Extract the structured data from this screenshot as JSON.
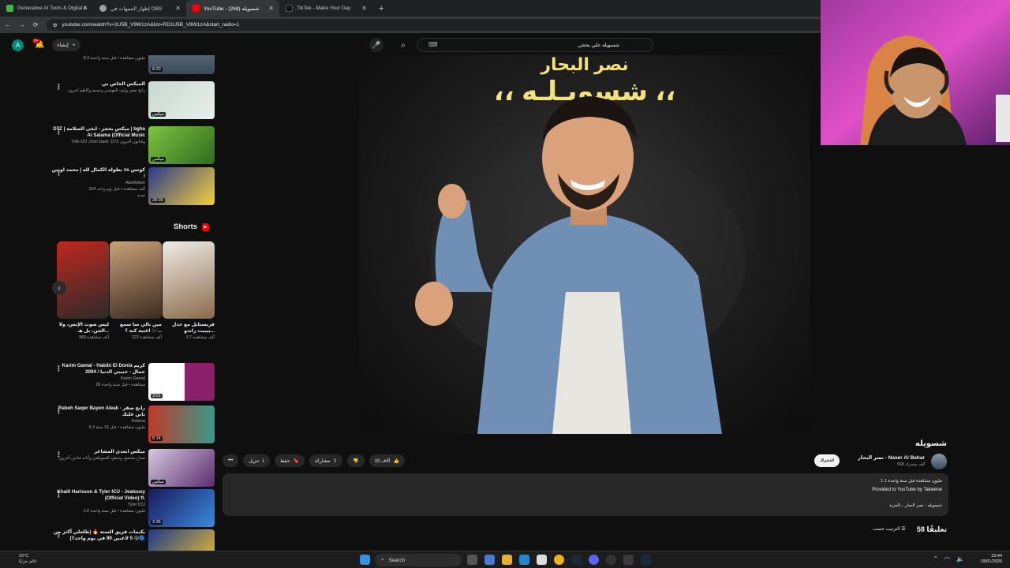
{
  "browser": {
    "tabs": [
      {
        "label": "Generative AI Tools & Digital A",
        "active": false,
        "color": "#4caf50"
      },
      {
        "label": "إظهار التنبيهات في OBS",
        "active": false,
        "color": "#9e9e9e"
      },
      {
        "label": "YouTube - شسويله (268)",
        "active": true,
        "color": "#ff0000"
      },
      {
        "label": "TikTok - Make Your Day",
        "active": false,
        "color": "#111111"
      }
    ],
    "url": "youtube.com/watch?v=1U5B_V9W1zA&list=RD1U5B_V9W1zA&start_radio=1"
  },
  "youtube": {
    "avatar_letter": "A",
    "notif_count": "9+",
    "create_label": "إنشاء",
    "search_value": "شسويله حلي يحجي"
  },
  "sidebar": {
    "top_dur": "8:20",
    "top_meta": "8.3 مليون مشاهدة • قبل سنة واحدة",
    "items": [
      {
        "title": "الميكس الخاص بي",
        "channel": "رابح صقر وإيف العوضي ونسيم وكاظم آخرون",
        "meta": "",
        "dur": "ميكس",
        "color1": "#c8d8d0",
        "color2": "#e8f0ec"
      },
      {
        "title": "D7Z | ميكس بحجز - ابغى السلامة | bgha Al Salama (Official Music",
        "channel": "THE DO ,Dish Dash ,D7Z وفنانون آخرون",
        "meta": "",
        "dur": "ميكس",
        "color1": "#7fc342",
        "color2": "#2f6b1f"
      },
      {
        "title": "بطولة الكمال لله | محمد اوبين vs كوتس !",
        "channel": "AbuRebeh",
        "meta": "324 ألف مشاهدة • قبل يوم واحد",
        "dur": "28:05",
        "badge": "جديد",
        "color1": "#2a3a8a",
        "color2": "#f6d03a"
      },
      {
        "title": "Karim Gamal - Habibi El Donia كريم جمال - حبيبي الدنيا / 2004",
        "channel": "Karim Gamal",
        "meta": "26 مشاهدة • قبل سنة واحدة",
        "dur": "3:01",
        "color1": "#ffffff",
        "color2": "#8a1f6a"
      },
      {
        "title": "Rabeh Saqer Bayen Aleak رابح صقر - باين عليك",
        "channel": "Rotana",
        "meta": "6.3 مليون مشاهدة • قبل 13 سنة",
        "dur": "5:14",
        "color1": "#c0392b",
        "color2": "#3a9a8a"
      },
      {
        "title": "ميكس ابعدي المشاعر",
        "channel": "صباح مسعود وسعود السويلمي وأيانه فنانين آخرون",
        "meta": "",
        "dur": "ميكس",
        "color1": "#d6c9e0",
        "color2": "#5b2d6e"
      },
      {
        "title": "Khalil Harisson & Tyler ICU - Jealousy (Official Video) ft.",
        "channel": "Tyler ICU",
        "meta": "1.6 مليون مشاهدة • قبل سنة واحدة",
        "dur": "3:36",
        "color1": "#1a1a5a",
        "color2": "#3a8adf"
      },
      {
        "title": "بكيمات فريق السنة 🔥 (طلعلي أكثر من 5 لاعبين 99 في يوم واحد!!) 😲🔵",
        "channel": "",
        "meta": "",
        "dur": "x5",
        "color1": "#1a3a8a",
        "color2": "#f0c030"
      }
    ],
    "shorts_title": "Shorts",
    "shorts": [
      {
        "title": "فريستايل مع حدل بيبيت راندو...",
        "views": "3.7 ألف مشاهدة",
        "color1": "#f0ece6",
        "color2": "#8a6a4a"
      },
      {
        "title": "مين بالي سا سمع اغنية كنة ؟ 🎶...",
        "views": "223 ألف مشاهدة",
        "color1": "#c9a07a",
        "color2": "#3a2a20"
      },
      {
        "title": "ليس صوت الإنس، ولا الجن، بل هـ...",
        "views": "966 ألف مشاهدة",
        "color1": "#c0281e",
        "color2": "#2a2a2a"
      }
    ]
  },
  "player": {
    "overlay_top": "نصر البحار",
    "overlay_title": "،، شسويـلـه ،،"
  },
  "video": {
    "title": "شسويله",
    "channel_name": "نصر البحار - Naser Al Bahar",
    "channel_subs": "568 ألف مشترك",
    "subscribe": "اشترك",
    "likes": "10 آلاف",
    "share": "مشاركة",
    "save": "حفظ",
    "download": "تنزيل",
    "desc_line1": "1.1 مليون مشاهدة قبل سنة واحدة",
    "desc_line2": "Provided to YouTube by Takwene",
    "desc_line3": "شسويله · نصر البحار ...المزيد"
  },
  "comments": {
    "count_label": "58 تعليقًا",
    "sort_label": "الترتيب حسب"
  },
  "taskbar": {
    "temp": "22°C",
    "weather": "غائم جزئيًا",
    "search": "Search",
    "time": "23:44",
    "date": "19/01/2026"
  }
}
